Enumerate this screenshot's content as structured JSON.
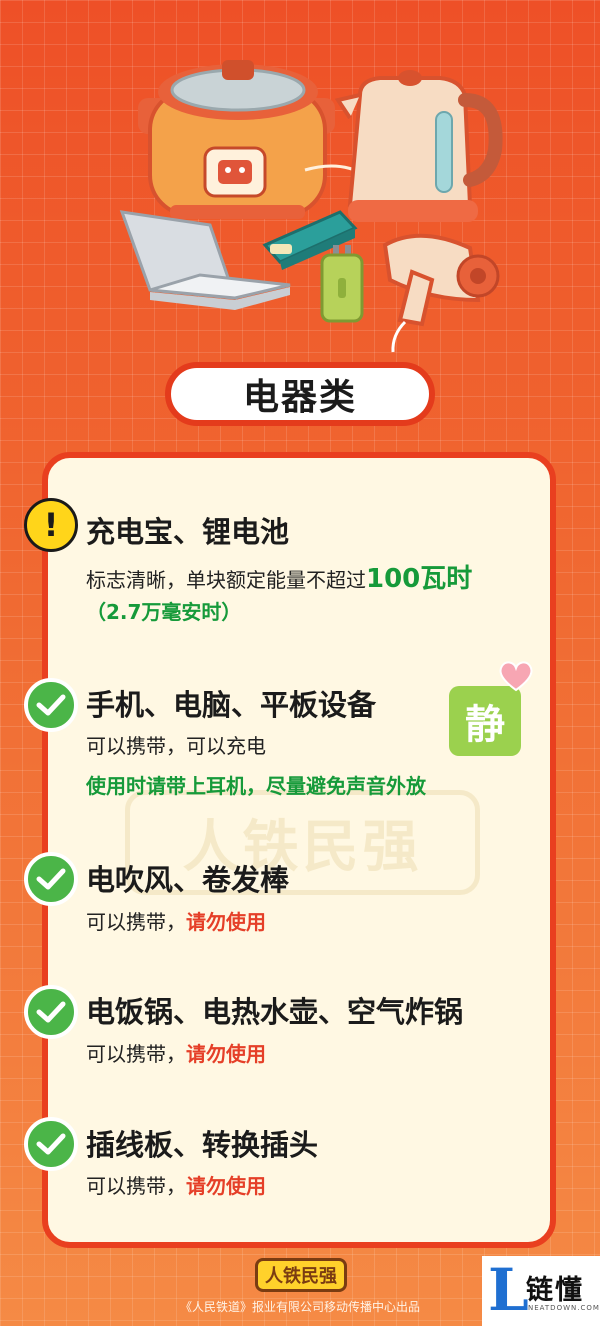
{
  "category_title": "电器类",
  "watermark": "人铁民强",
  "items": [
    {
      "status": "warning",
      "title": "充电宝、锂电池",
      "line1_prefix": "标志清晰，单块额定能量不超过",
      "line1_highlight": "100瓦时",
      "line2": "（2.7万毫安时）"
    },
    {
      "status": "allowed",
      "title": "手机、电脑、平板设备",
      "line1": "可以携带，可以充电",
      "line2": "使用时请带上耳机，尽量避免声音外放",
      "sticker": "静"
    },
    {
      "status": "allowed",
      "title": "电吹风、卷发棒",
      "line1_prefix": "可以携带，",
      "line1_highlight": "请勿使用"
    },
    {
      "status": "allowed",
      "title": "电饭锅、电热水壶、空气炸锅",
      "line1_prefix": "可以携带，",
      "line1_highlight": "请勿使用"
    },
    {
      "status": "allowed",
      "title": "插线板、转换插头",
      "line1_prefix": "可以携带，",
      "line1_highlight": "请勿使用"
    }
  ],
  "footer": {
    "logo": "人铁民强",
    "credit": "《人民铁道》报业有限公司移动传播中心出品"
  },
  "corner_badge": {
    "letter": "L",
    "name": "链懂",
    "domain": "NEATDOWN.COM"
  },
  "colors": {
    "background": "#ef5a2a",
    "card": "#fff8e3",
    "border": "#e93f1f",
    "green": "#169a3a",
    "red": "#e53f28",
    "check": "#4bb548",
    "warning": "#ffd51a"
  }
}
